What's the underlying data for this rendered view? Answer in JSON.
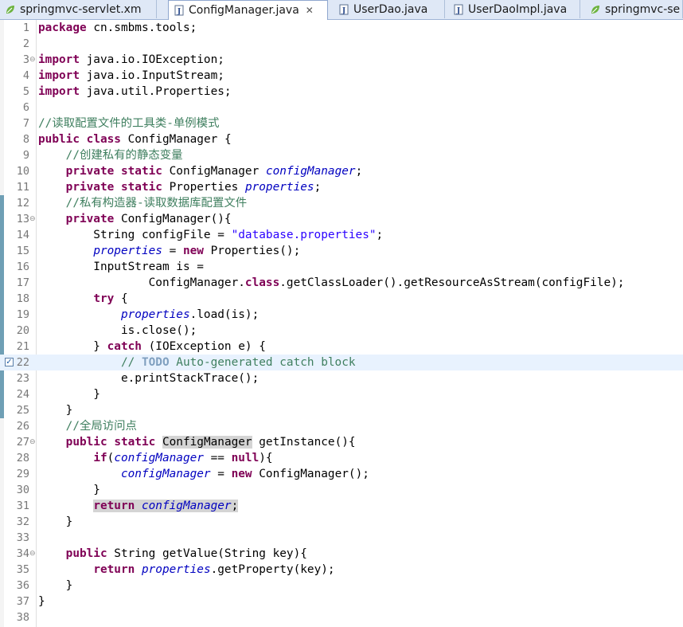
{
  "tabs": [
    {
      "label": "springmvc-servlet.xm",
      "icon": "spring-xml-icon",
      "active": false
    },
    {
      "label": "ConfigManager.java",
      "icon": "java-file-icon",
      "active": true
    },
    {
      "label": "UserDao.java",
      "icon": "java-file-icon",
      "active": false
    },
    {
      "label": "UserDaoImpl.java",
      "icon": "java-file-icon",
      "active": false
    },
    {
      "label": "springmvc-se",
      "icon": "spring-xml-icon",
      "active": false
    }
  ],
  "close_glyph": "✕",
  "fold_glyph": "⊖",
  "task_glyph": "✓",
  "highlight_line": 22,
  "lines": [
    {
      "n": "1",
      "fold": false,
      "tokens": [
        [
          "kw",
          "package"
        ],
        [
          "p",
          " cn.smbms.tools;"
        ]
      ]
    },
    {
      "n": "2",
      "fold": false,
      "tokens": []
    },
    {
      "n": "3",
      "fold": true,
      "tokens": [
        [
          "kw",
          "import"
        ],
        [
          "p",
          " java.io.IOException;"
        ]
      ]
    },
    {
      "n": "4",
      "fold": false,
      "tokens": [
        [
          "kw",
          "import"
        ],
        [
          "p",
          " java.io.InputStream;"
        ]
      ]
    },
    {
      "n": "5",
      "fold": false,
      "tokens": [
        [
          "kw",
          "import"
        ],
        [
          "p",
          " java.util.Properties;"
        ]
      ]
    },
    {
      "n": "6",
      "fold": false,
      "tokens": []
    },
    {
      "n": "7",
      "fold": false,
      "tokens": [
        [
          "cm",
          "//读取配置文件的工具类-单例模式"
        ]
      ]
    },
    {
      "n": "8",
      "fold": false,
      "tokens": [
        [
          "kw",
          "public"
        ],
        [
          "p",
          " "
        ],
        [
          "kw",
          "class"
        ],
        [
          "p",
          " ConfigManager {"
        ]
      ]
    },
    {
      "n": "9",
      "fold": false,
      "tokens": [
        [
          "p",
          "    "
        ],
        [
          "cm",
          "//创建私有的静态变量"
        ]
      ]
    },
    {
      "n": "10",
      "fold": false,
      "tokens": [
        [
          "p",
          "    "
        ],
        [
          "kw",
          "private"
        ],
        [
          "p",
          " "
        ],
        [
          "kw",
          "static"
        ],
        [
          "p",
          " ConfigManager "
        ],
        [
          "fd",
          "configManager"
        ],
        [
          "p",
          ";"
        ]
      ]
    },
    {
      "n": "11",
      "fold": false,
      "tokens": [
        [
          "p",
          "    "
        ],
        [
          "kw",
          "private"
        ],
        [
          "p",
          " "
        ],
        [
          "kw",
          "static"
        ],
        [
          "p",
          " Properties "
        ],
        [
          "fd",
          "properties"
        ],
        [
          "p",
          ";"
        ]
      ]
    },
    {
      "n": "12",
      "fold": false,
      "tokens": [
        [
          "p",
          "    "
        ],
        [
          "cm",
          "//私有构造器-读取数据库配置文件"
        ]
      ]
    },
    {
      "n": "13",
      "fold": true,
      "tokens": [
        [
          "p",
          "    "
        ],
        [
          "kw",
          "private"
        ],
        [
          "p",
          " ConfigManager(){"
        ]
      ]
    },
    {
      "n": "14",
      "fold": false,
      "tokens": [
        [
          "p",
          "        String configFile = "
        ],
        [
          "str",
          "\"database.properties\""
        ],
        [
          "p",
          ";"
        ]
      ]
    },
    {
      "n": "15",
      "fold": false,
      "tokens": [
        [
          "p",
          "        "
        ],
        [
          "fd",
          "properties"
        ],
        [
          "p",
          " = "
        ],
        [
          "kw",
          "new"
        ],
        [
          "p",
          " Properties();"
        ]
      ]
    },
    {
      "n": "16",
      "fold": false,
      "tokens": [
        [
          "p",
          "        InputStream is ="
        ]
      ]
    },
    {
      "n": "17",
      "fold": false,
      "tokens": [
        [
          "p",
          "                ConfigManager."
        ],
        [
          "kw",
          "class"
        ],
        [
          "p",
          ".getClassLoader().getResourceAsStream(configFile);"
        ]
      ]
    },
    {
      "n": "18",
      "fold": false,
      "tokens": [
        [
          "p",
          "        "
        ],
        [
          "kw",
          "try"
        ],
        [
          "p",
          " {"
        ]
      ]
    },
    {
      "n": "19",
      "fold": false,
      "tokens": [
        [
          "p",
          "            "
        ],
        [
          "fd",
          "properties"
        ],
        [
          "p",
          ".load(is);"
        ]
      ]
    },
    {
      "n": "20",
      "fold": false,
      "tokens": [
        [
          "p",
          "            is.close();"
        ]
      ]
    },
    {
      "n": "21",
      "fold": false,
      "tokens": [
        [
          "p",
          "        } "
        ],
        [
          "kw",
          "catch"
        ],
        [
          "p",
          " (IOException e) {"
        ]
      ]
    },
    {
      "n": "22",
      "fold": false,
      "tokens": [
        [
          "p",
          "            "
        ],
        [
          "cm",
          "// "
        ],
        [
          "todo",
          "TODO"
        ],
        [
          "cm",
          " Auto-generated catch block"
        ]
      ]
    },
    {
      "n": "23",
      "fold": false,
      "tokens": [
        [
          "p",
          "            e.printStackTrace();"
        ]
      ]
    },
    {
      "n": "24",
      "fold": false,
      "tokens": [
        [
          "p",
          "        }"
        ]
      ]
    },
    {
      "n": "25",
      "fold": false,
      "tokens": [
        [
          "p",
          "    }"
        ]
      ]
    },
    {
      "n": "26",
      "fold": false,
      "tokens": [
        [
          "p",
          "    "
        ],
        [
          "cm",
          "//全局访问点"
        ]
      ]
    },
    {
      "n": "27",
      "fold": true,
      "tokens": [
        [
          "p",
          "    "
        ],
        [
          "kw",
          "public"
        ],
        [
          "p",
          " "
        ],
        [
          "kw",
          "static"
        ],
        [
          "p",
          " "
        ],
        [
          "occ",
          "ConfigManager"
        ],
        [
          "p",
          " getInstance(){"
        ]
      ]
    },
    {
      "n": "28",
      "fold": false,
      "tokens": [
        [
          "p",
          "        "
        ],
        [
          "kw",
          "if"
        ],
        [
          "p",
          "("
        ],
        [
          "fd",
          "configManager"
        ],
        [
          "p",
          " == "
        ],
        [
          "kw",
          "null"
        ],
        [
          "p",
          "){"
        ]
      ]
    },
    {
      "n": "29",
      "fold": false,
      "tokens": [
        [
          "p",
          "            "
        ],
        [
          "fd",
          "configManager"
        ],
        [
          "p",
          " = "
        ],
        [
          "kw",
          "new"
        ],
        [
          "p",
          " ConfigManager();"
        ]
      ]
    },
    {
      "n": "30",
      "fold": false,
      "tokens": [
        [
          "p",
          "        }"
        ]
      ]
    },
    {
      "n": "31",
      "fold": false,
      "tokens": [
        [
          "p",
          "        "
        ],
        [
          "kw",
          "return"
        ],
        [
          "p",
          " "
        ],
        [
          "fd",
          "configManager"
        ],
        [
          "p",
          ";"
        ]
      ],
      "occ_line": true
    },
    {
      "n": "32",
      "fold": false,
      "tokens": [
        [
          "p",
          "    }"
        ]
      ]
    },
    {
      "n": "33",
      "fold": false,
      "tokens": []
    },
    {
      "n": "34",
      "fold": true,
      "tokens": [
        [
          "p",
          "    "
        ],
        [
          "kw",
          "public"
        ],
        [
          "p",
          " String getValue(String key){"
        ]
      ]
    },
    {
      "n": "35",
      "fold": false,
      "tokens": [
        [
          "p",
          "        "
        ],
        [
          "kw",
          "return"
        ],
        [
          "p",
          " "
        ],
        [
          "fd",
          "properties"
        ],
        [
          "p",
          ".getProperty(key);"
        ]
      ]
    },
    {
      "n": "36",
      "fold": false,
      "tokens": [
        [
          "p",
          "    }"
        ]
      ]
    },
    {
      "n": "37",
      "fold": false,
      "tokens": [
        [
          "p",
          "}"
        ]
      ]
    },
    {
      "n": "38",
      "fold": false,
      "tokens": []
    }
  ]
}
